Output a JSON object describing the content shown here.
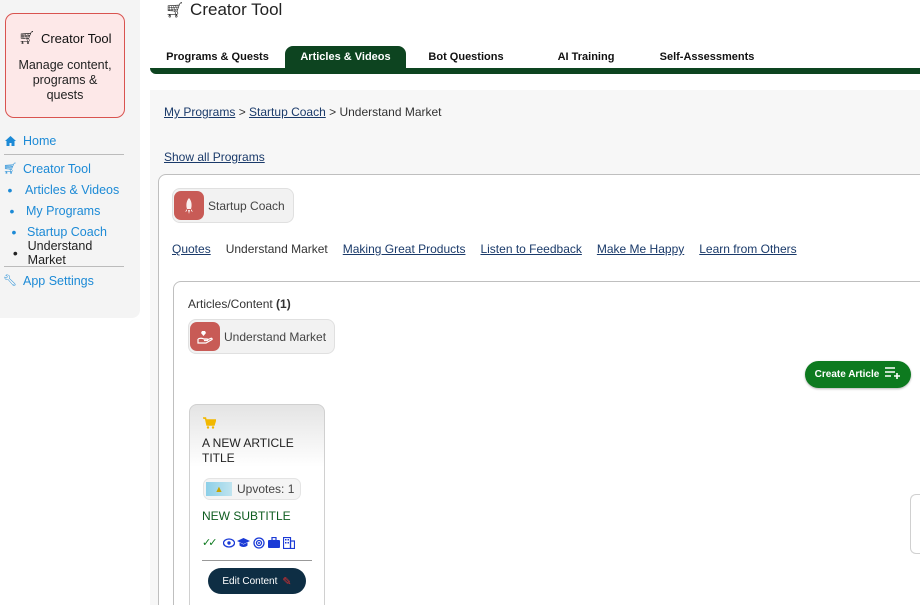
{
  "sidebar": {
    "card_title": "Creator Tool",
    "card_desc": "Manage content, programs & quests",
    "items": [
      {
        "label": "Home",
        "icon": "home-icon"
      },
      {
        "label": "Creator Tool",
        "icon": "cart-icon"
      },
      {
        "label": "Articles & Videos",
        "icon": "bullet"
      },
      {
        "label": "My Programs",
        "icon": "bullet"
      },
      {
        "label": "Startup Coach",
        "icon": "bullet"
      },
      {
        "label": "Understand Market",
        "icon": "bullet"
      },
      {
        "label": "App Settings",
        "icon": "wrench-icon"
      }
    ]
  },
  "header": {
    "title": "Creator Tool"
  },
  "tabs": [
    {
      "label": "Programs & Quests"
    },
    {
      "label": "Articles & Videos",
      "active": true
    },
    {
      "label": "Bot Questions"
    },
    {
      "label": "AI Training"
    },
    {
      "label": "Self-Assessments"
    }
  ],
  "breadcrumb": {
    "crumb1": "My Programs",
    "sep": ">",
    "crumb2": "Startup Coach",
    "current": "Understand Market"
  },
  "show_all": "Show all Programs",
  "program": {
    "chip_label": "Startup Coach"
  },
  "quests": [
    "Quotes",
    "Understand Market",
    "Making Great Products",
    "Listen to Feedback",
    "Make Me Happy",
    "Learn from Others"
  ],
  "articles": {
    "heading": "Articles/Content",
    "count": "(1)",
    "quest_chip": "Understand Market",
    "create_label": "Create Article"
  },
  "article_card": {
    "title": "A NEW ARTICLE TITLE",
    "upvotes": "Upvotes: 1",
    "subtitle": "NEW SUBTITLE",
    "edit_label": "Edit Content"
  },
  "colors": {
    "brand_green": "#0d4420",
    "accent_blue": "#1c8ad6",
    "create_green": "#0d7a1f",
    "edit_navy": "#0e2e44"
  }
}
